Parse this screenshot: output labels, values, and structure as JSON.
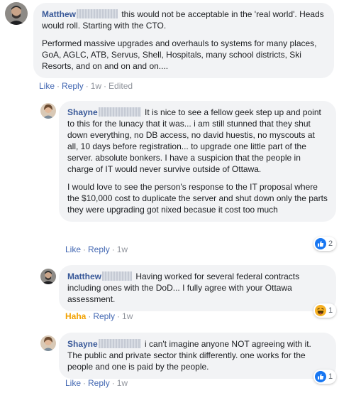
{
  "comments": [
    {
      "author": "Matthew",
      "paragraphs": [
        "this would not be acceptable in the 'real world'. Heads would roll. Starting with the CTO.",
        "Performed massive upgrades and overhauls to systems for many places, GoA, AGLC, ATB, Servus, Shell, Hospitals, many school districts, Ski Resorts, and on and on and on...."
      ],
      "actions": {
        "like": "Like",
        "reply": "Reply",
        "time": "1w",
        "edited": "Edited"
      }
    },
    {
      "author": "Shayne",
      "paragraphs": [
        "It is nice to see a fellow geek step up and point to this for the lunacy that it was... i am still stunned that they shut down everything, no DB access, no david huestis, no myscouts at all, 10 days before registration... to upgrade one little part of the server. absolute bonkers. I have a suspicion that the people in charge of IT would never survive outside of Ottawa.",
        "I would love to see the person's response to the IT proposal where the $10,000 cost to duplicate the server and shut down only the parts they were upgrading got nixed becasue it cost too much"
      ],
      "actions": {
        "like": "Like",
        "reply": "Reply",
        "time": "1w"
      },
      "reaction": {
        "icon": "like-reaction-icon",
        "count": "2",
        "color": "#1877f2"
      }
    },
    {
      "author": "Matthew",
      "paragraphs": [
        "Having worked for several federal contracts including ones with the DoD... I fully agree with your Ottawa assessment."
      ],
      "actions": {
        "like": "Haha",
        "reply": "Reply",
        "time": "1w"
      },
      "reaction": {
        "icon": "haha-reaction-icon",
        "count": "1",
        "color": "#f7b125"
      }
    },
    {
      "author": "Shayne",
      "paragraphs": [
        "i can't imagine anyone NOT agreeing with it. The public and private sector think differently. one works for the people and one is paid by the people."
      ],
      "actions": {
        "like": "Like",
        "reply": "Reply",
        "time": "1w"
      },
      "reaction": {
        "icon": "like-reaction-icon",
        "count": "1",
        "color": "#1877f2"
      }
    }
  ]
}
